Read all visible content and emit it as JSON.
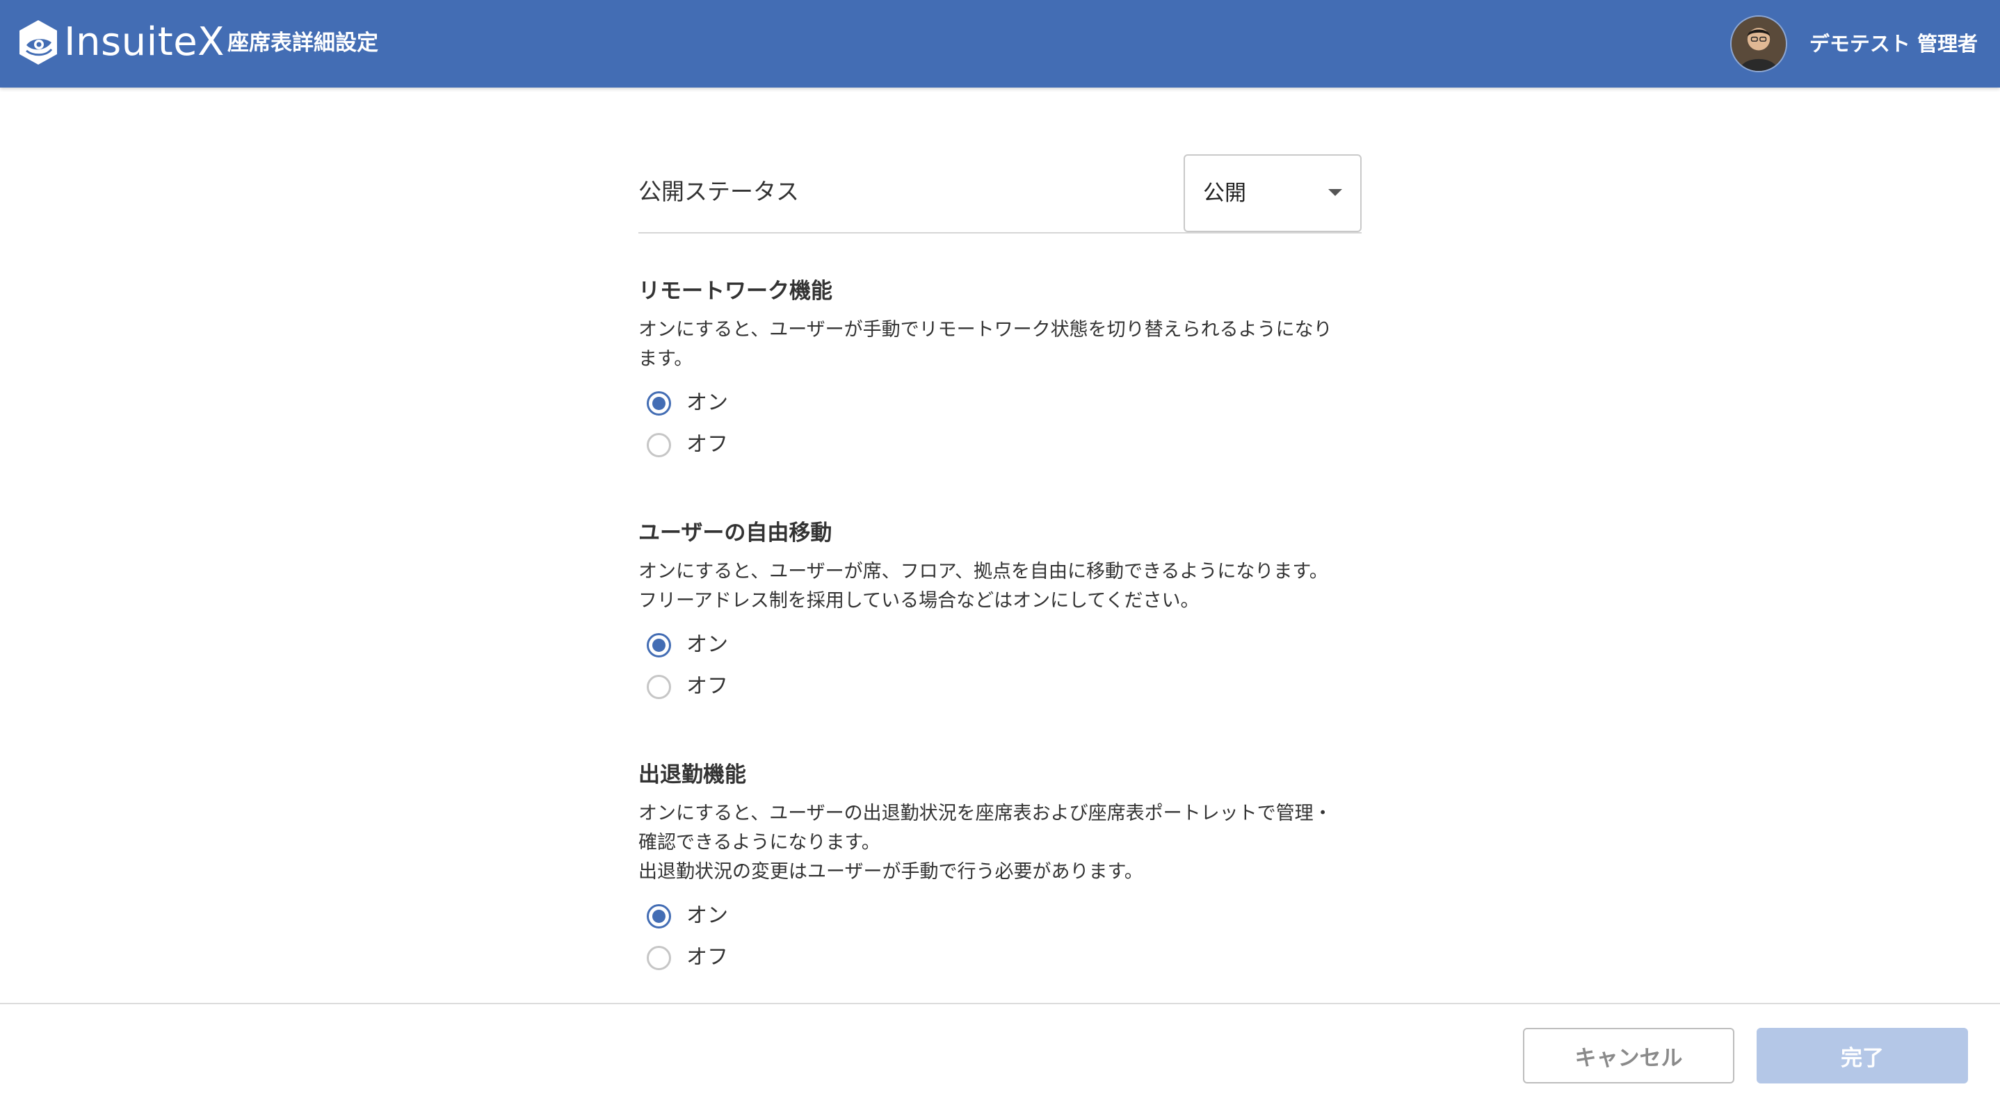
{
  "theme": {
    "accent": "#436db4",
    "accent_disabled": "#b4c7e7"
  },
  "header": {
    "app_name": "InsuiteX",
    "page_title": "座席表詳細設定",
    "user_name": "デモテスト 管理者"
  },
  "publish_status": {
    "label": "公開ステータス",
    "value": "公開"
  },
  "sections": [
    {
      "title": "リモートワーク機能",
      "description": "オンにすると、ユーザーが手動でリモートワーク状態を切り替えられるようになり\nます。",
      "selected": "on",
      "options": [
        {
          "label": "オン",
          "checked": true
        },
        {
          "label": "オフ",
          "checked": false
        }
      ]
    },
    {
      "title": "ユーザーの自由移動",
      "description": "オンにすると、ユーザーが席、フロア、拠点を自由に移動できるようになります。\nフリーアドレス制を採用している場合などはオンにしてください。",
      "selected": "on",
      "options": [
        {
          "label": "オン",
          "checked": true
        },
        {
          "label": "オフ",
          "checked": false
        }
      ]
    },
    {
      "title": "出退勤機能",
      "description": "オンにすると、ユーザーの出退勤状況を座席表および座席表ポートレットで管理・\n確認できるようになります。\n出退勤状況の変更はユーザーが手動で行う必要があります。",
      "selected": "on",
      "options": [
        {
          "label": "オン",
          "checked": true
        },
        {
          "label": "オフ",
          "checked": false
        }
      ]
    }
  ],
  "footer": {
    "cancel_label": "キャンセル",
    "done_label": "完了",
    "done_enabled": false
  }
}
